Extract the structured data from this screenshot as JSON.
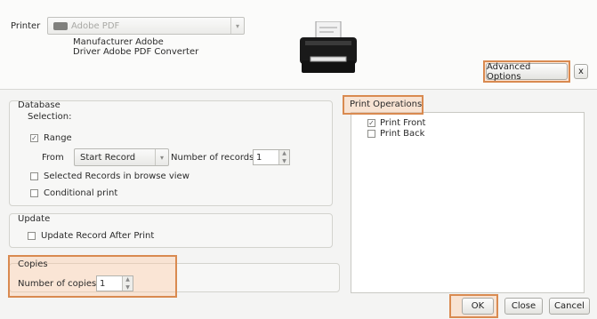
{
  "printer": {
    "label": "Printer",
    "selected": "Adobe PDF",
    "manufacturer": "Manufacturer Adobe",
    "driver": "Driver Adobe PDF Converter"
  },
  "advanced_options_label": "Advanced Options",
  "close_x_label": "x",
  "database": {
    "title": "Database",
    "selection_label": "Selection:",
    "range_label": "Range",
    "range_checked": true,
    "from_label": "From",
    "from_value": "Start Record",
    "number_of_records_label": "Number of records",
    "number_of_records_value": "1",
    "selected_records_label": "Selected Records in browse view",
    "conditional_print_label": "Conditional print"
  },
  "update": {
    "title": "Update",
    "update_record_label": "Update Record After Print"
  },
  "copies": {
    "title": "Copies",
    "number_label": "Number of copies",
    "number_value": "1"
  },
  "print_operations": {
    "title": "Print Operations",
    "items": [
      {
        "label": "Print Front",
        "checked": true
      },
      {
        "label": "Print Back",
        "checked": false
      }
    ]
  },
  "buttons": {
    "ok": "OK",
    "close": "Close",
    "cancel": "Cancel"
  },
  "colors": {
    "highlight_border": "#d98a50",
    "highlight_fill": "#ffc8a0"
  }
}
